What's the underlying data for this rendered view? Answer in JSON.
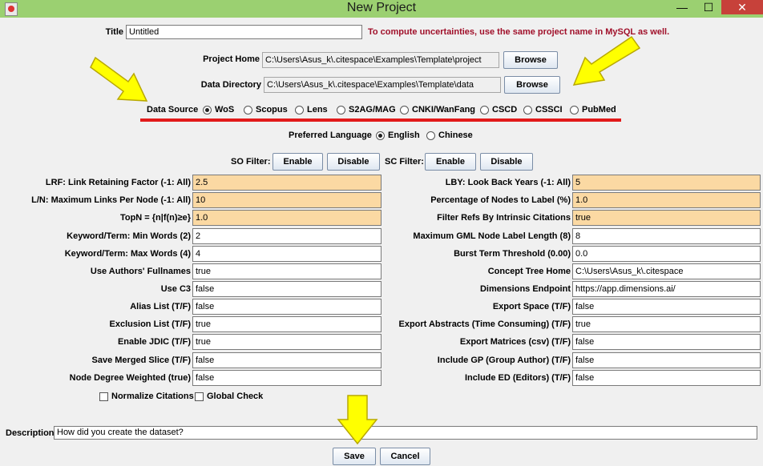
{
  "window": {
    "title": "New Project",
    "minimize": "—",
    "maximize": "☐",
    "close": "✕"
  },
  "title_field": {
    "label": "Title",
    "value": "Untitled",
    "warning": "To compute uncertainties, use the same project name in MySQL as well."
  },
  "project_home": {
    "label": "Project Home",
    "value": "C:\\Users\\Asus_k\\.citespace\\Examples\\Template\\project",
    "button": "Browse"
  },
  "data_directory": {
    "label": "Data Directory",
    "value": "C:\\Users\\Asus_k\\.citespace\\Examples\\Template\\data",
    "button": "Browse"
  },
  "data_source": {
    "label": "Data Source",
    "selected": "WoS",
    "options": [
      "WoS",
      "Scopus",
      "Lens",
      "S2AG/MAG",
      "CNKI/WanFang",
      "CSCD",
      "CSSCI",
      "PubMed"
    ]
  },
  "language": {
    "label": "Preferred Language",
    "selected": "English",
    "options": [
      "English",
      "Chinese"
    ]
  },
  "filters": {
    "so_label": "SO Filter:",
    "sc_label": "SC Filter:",
    "enable": "Enable",
    "disable": "Disable"
  },
  "left_params": [
    {
      "label": "LRF: Link Retaining Factor (-1: All)",
      "value": "2.5",
      "highlight": true
    },
    {
      "label": "L/N: Maximum Links Per Node (-1: All)",
      "value": "10",
      "highlight": true
    },
    {
      "label": "TopN = {n|f(n)≥e}",
      "value": "1.0",
      "highlight": true
    },
    {
      "label": "Keyword/Term: Min Words (2)",
      "value": "2",
      "highlight": false
    },
    {
      "label": "Keyword/Term: Max Words (4)",
      "value": "4",
      "highlight": false
    },
    {
      "label": "Use Authors' Fullnames",
      "value": "true",
      "highlight": false
    },
    {
      "label": "Use C3",
      "value": "false",
      "highlight": false
    },
    {
      "label": "Alias List (T/F)",
      "value": "false",
      "highlight": false
    },
    {
      "label": "Exclusion List (T/F)",
      "value": "true",
      "highlight": false
    },
    {
      "label": "Enable JDIC (T/F)",
      "value": "true",
      "highlight": false
    },
    {
      "label": "Save Merged Slice (T/F)",
      "value": "false",
      "highlight": false
    },
    {
      "label": "Node Degree Weighted (true)",
      "value": "false",
      "highlight": false
    }
  ],
  "right_params": [
    {
      "label": "LBY: Look Back Years (-1: All)",
      "value": "5",
      "highlight": true
    },
    {
      "label": "Percentage of Nodes to Label (%)",
      "value": "1.0",
      "highlight": true
    },
    {
      "label": "Filter Refs By Intrinsic Citations",
      "value": "true",
      "highlight": true
    },
    {
      "label": "Maximum GML Node Label Length (8)",
      "value": "8",
      "highlight": false
    },
    {
      "label": "Burst Term Threshold (0.00)",
      "value": "0.0",
      "highlight": false
    },
    {
      "label": "Concept Tree Home",
      "value": "C:\\Users\\Asus_k\\.citespace",
      "highlight": false
    },
    {
      "label": "Dimensions Endpoint",
      "value": "https://app.dimensions.ai/",
      "highlight": false
    },
    {
      "label": "Export Space (T/F)",
      "value": "false",
      "highlight": false
    },
    {
      "label": "Export Abstracts (Time Consuming) (T/F)",
      "value": "true",
      "highlight": false
    },
    {
      "label": "Export Matrices (csv) (T/F)",
      "value": "false",
      "highlight": false
    },
    {
      "label": "Include GP (Group Author) (T/F)",
      "value": "false",
      "highlight": false
    },
    {
      "label": "Include ED (Editors) (T/F)",
      "value": "false",
      "highlight": false
    }
  ],
  "checkboxes": [
    {
      "label": "Normalize Citations",
      "checked": false
    },
    {
      "label": "Global Check",
      "checked": false
    }
  ],
  "description": {
    "label": "Description",
    "value": "How did you create the dataset?"
  },
  "actions": {
    "save": "Save",
    "cancel": "Cancel"
  },
  "colors": {
    "titlebar": "#9bd071",
    "highlight_field": "#fbd9a3",
    "warning_text": "#a0102a",
    "annotation_arrow": "#ffff00",
    "annotation_line": "#e21a1a"
  },
  "annotations": [
    "arrow-icon",
    "arrow-icon",
    "arrow-icon",
    "underline"
  ]
}
